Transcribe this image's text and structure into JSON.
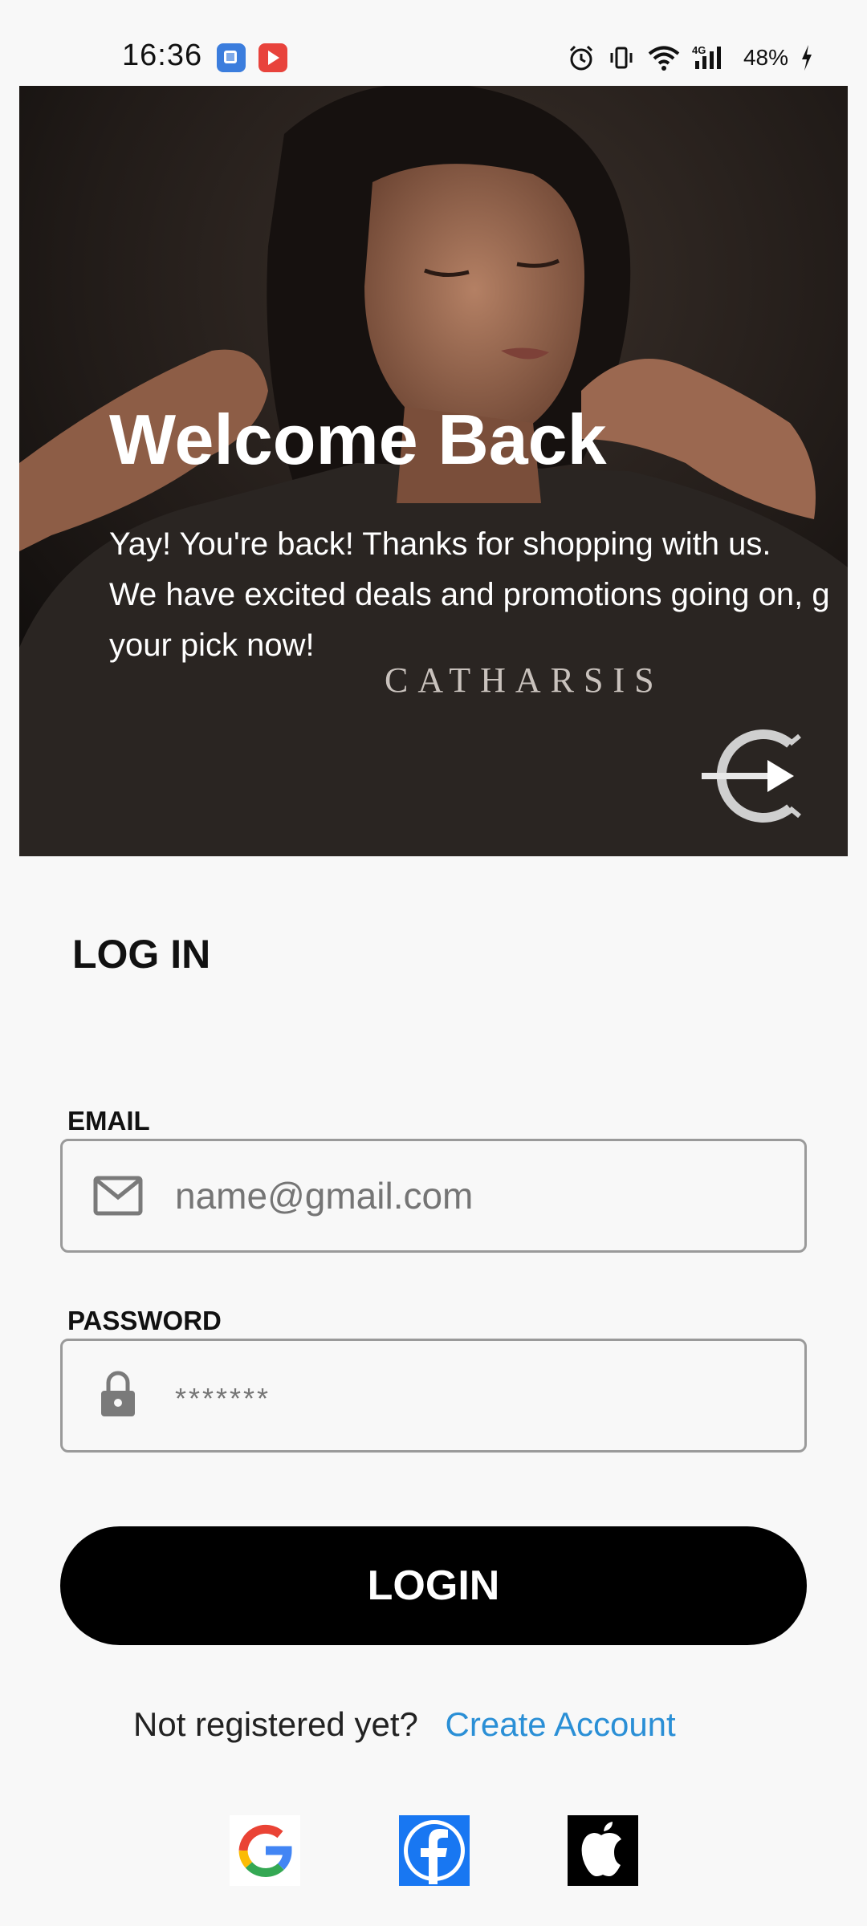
{
  "status_bar": {
    "time": "16:36",
    "network": "4G",
    "battery": "48%"
  },
  "hero": {
    "title": "Welcome Back",
    "text_lines": [
      "Yay! You're back! Thanks for shopping with us.",
      "We have excited deals and promotions going on, g",
      "your pick now!"
    ],
    "brand_wordmark": "CATHARSIS"
  },
  "login": {
    "heading": "LOG IN",
    "email_label": "EMAIL",
    "email_placeholder": "name@gmail.com",
    "password_label": "PASSWORD",
    "password_placeholder": "*******",
    "button_label": "LOGIN"
  },
  "signup": {
    "prompt": "Not registered yet?",
    "link_label": "Create Account"
  },
  "social": [
    {
      "name": "google",
      "icon": "google-icon"
    },
    {
      "name": "facebook",
      "icon": "facebook-icon"
    },
    {
      "name": "apple",
      "icon": "apple-icon"
    }
  ],
  "colors": {
    "background": "#f8f8f8",
    "primary_button": "#000000",
    "link": "#2a8fd6",
    "field_border": "#9a9a9a",
    "facebook_blue": "#1877f2"
  }
}
